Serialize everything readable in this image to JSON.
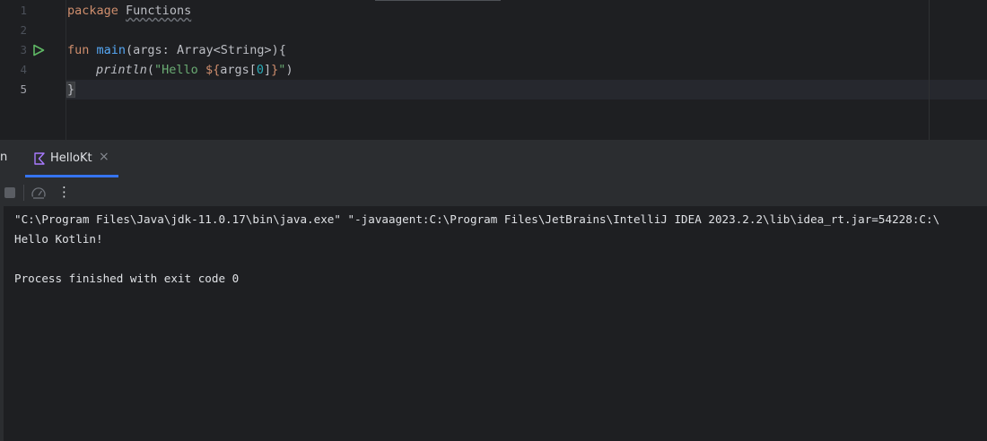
{
  "editor": {
    "line_numbers": [
      "1",
      "2",
      "3",
      "4",
      "5"
    ],
    "line1": {
      "keyword": "package",
      "name": "Functions"
    },
    "line3": {
      "keyword": "fun",
      "function": "main",
      "params": "(args: Array<String>)",
      "brace": "{"
    },
    "line4": {
      "call": "println",
      "open": "(",
      "str_start": "\"Hello ",
      "interp_open": "${",
      "expr": "args",
      "index_open": "[",
      "index": "0",
      "index_close": "]",
      "interp_close": "}",
      "str_end": "\"",
      "close": ")"
    },
    "line5": {
      "brace": "}"
    },
    "current_line": "5",
    "run_gutter_icon": "run-triangle-icon"
  },
  "run_panel": {
    "truncated_tab_label": "n",
    "tab": {
      "label": "HelloKt",
      "close": "×",
      "icon": "kotlin-icon"
    },
    "toolbar": {
      "stop_icon": "stop-icon",
      "profiler_icon": "gauge-icon",
      "more": "⋮"
    },
    "console": {
      "lines": [
        "\"C:\\Program Files\\Java\\jdk-11.0.17\\bin\\java.exe\" \"-javaagent:C:\\Program Files\\JetBrains\\IntelliJ IDEA 2023.2.2\\lib\\idea_rt.jar=54228:C:\\",
        "Hello Kotlin!",
        "",
        "Process finished with exit code 0"
      ]
    }
  },
  "colors": {
    "keyword": "#cf8e6d",
    "function": "#56a8f5",
    "string": "#6aab73",
    "number": "#2aacb8",
    "run_icon": "#5fb865",
    "accent": "#3574f0"
  }
}
